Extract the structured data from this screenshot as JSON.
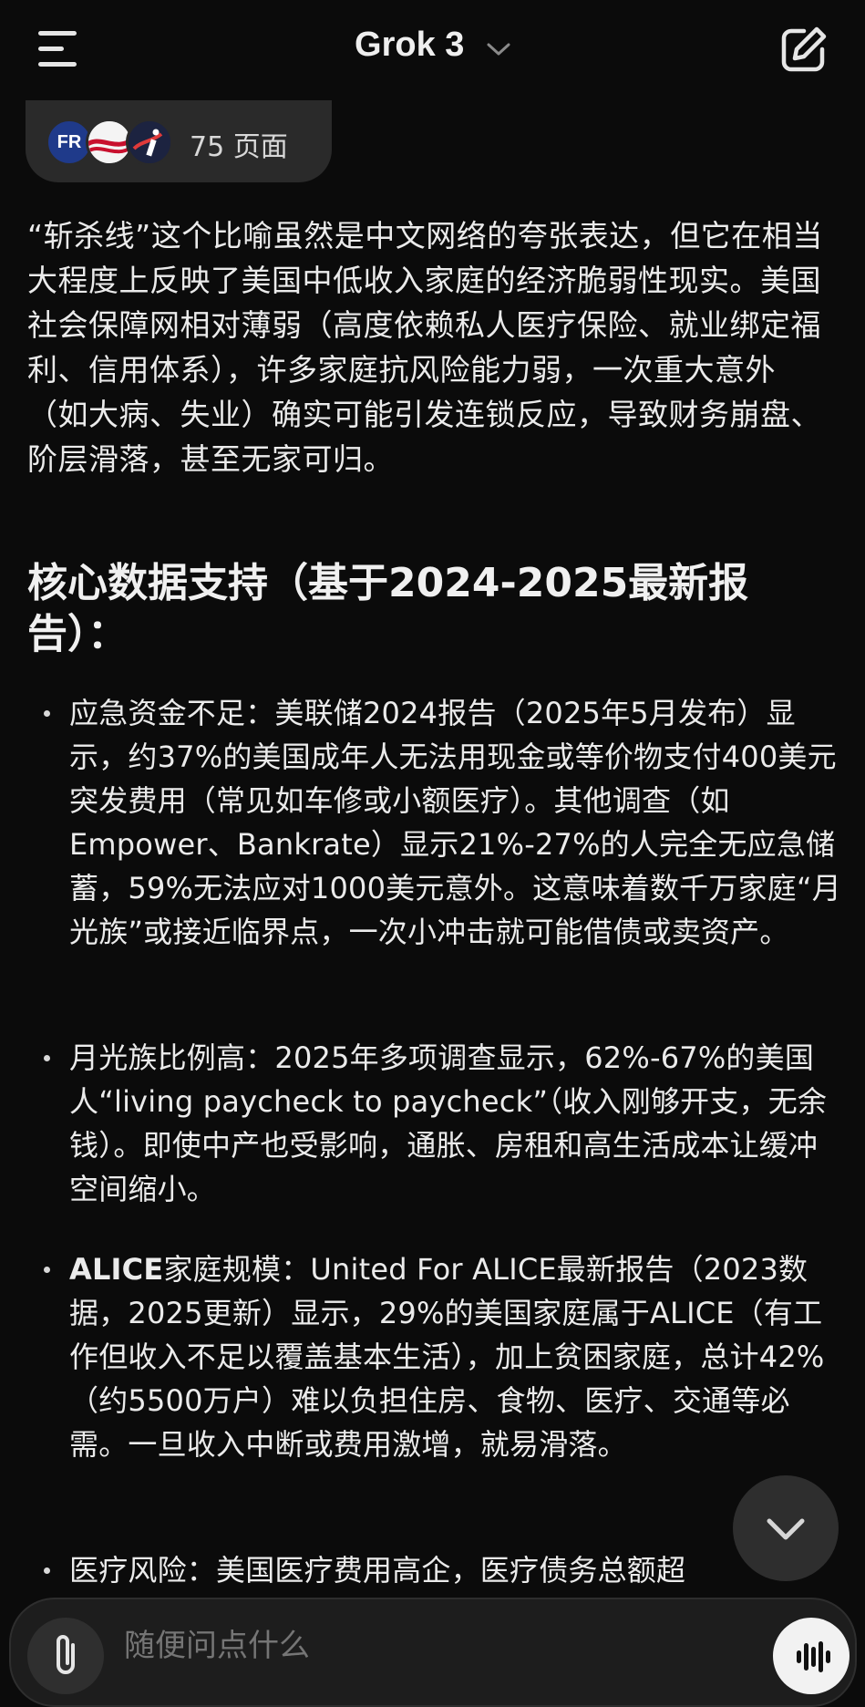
{
  "header": {
    "title": "Grok 3"
  },
  "sources": {
    "favicon_1": "FR",
    "label": "75 页面"
  },
  "intro": "“斩杀线”这个比喻虽然是中文网络的夸张表达，但它在相当大程度上反映了美国中低收入家庭的经济脆弱性现实。美国社会保障网相对薄弱（高度依赖私人医疗保险、就业绑定福利、信用体系），许多家庭抗风险能力弱，一次重大意外（如大病、失业）确实可能引发连锁反应，导致财务崩盘、阶层滑落，甚至无家可归。",
  "section_heading": "核心数据支持（基于2024-2025最新报告）：",
  "bullets": [
    {
      "lead": "",
      "text": "应急资金不足：美联储2024报告（2025年5月发布）显示，约37%的美国成年人无法用现金或等价物支付400美元突发费用（常见如车修或小额医疗）。其他调查（如Empower、Bankrate）显示21%-27%的人完全无应急储蓄，59%无法应对1000美元意外。这意味着数千万家庭“月光族”或接近临界点，一次小冲击就可能借债或卖资产。"
    },
    {
      "lead": "",
      "text": "月光族比例高：2025年多项调查显示，62%-67%的美国人“living paycheck to paycheck”（收入刚够开支，无余钱）。即使中产也受影响，通胀、房租和高生活成本让缓冲空间缩小。"
    },
    {
      "lead": "ALICE",
      "text": "家庭规模：United For ALICE最新报告（2023数据，2025更新）显示，29%的美国家庭属于ALICE（有工作但收入不足以覆盖基本生活），加上贫困家庭，总计42%（约5500万户）难以负担住房、食物、医疗、交通等必需。一旦收入中断或费用激增，就易滑落。"
    },
    {
      "lead": "",
      "text": "医疗风险：美国医疗费用高企，医疗债务总额超"
    }
  ],
  "composer": {
    "placeholder": "随便问点什么"
  },
  "colors": {
    "background": "#0b0b0b",
    "text": "#ebebeb",
    "pill": "#2a2a2a",
    "composer": "#1d1d1d"
  },
  "icons": [
    "menu-icon",
    "chevron-down-icon",
    "edit-icon",
    "chevron-down-icon",
    "paperclip-icon",
    "voice-wave-icon"
  ]
}
